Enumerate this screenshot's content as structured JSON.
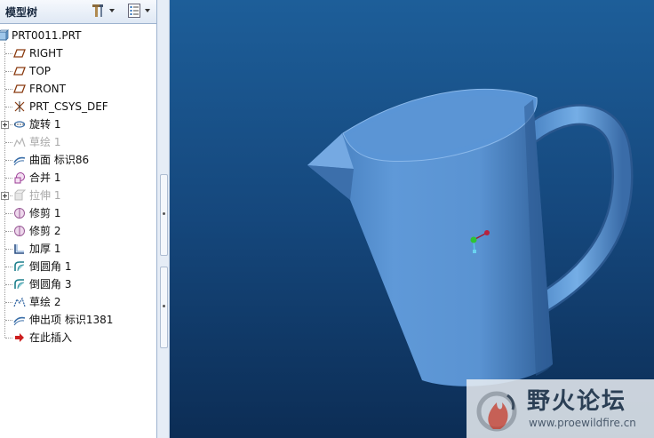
{
  "panel": {
    "title": "模型树"
  },
  "tree": {
    "items": [
      {
        "label": "PRT0011.PRT",
        "icon": "part-icon",
        "dim": false
      },
      {
        "label": "RIGHT",
        "icon": "datum-plane-icon",
        "dim": false
      },
      {
        "label": "TOP",
        "icon": "datum-plane-icon",
        "dim": false
      },
      {
        "label": "FRONT",
        "icon": "datum-plane-icon",
        "dim": false
      },
      {
        "label": "PRT_CSYS_DEF",
        "icon": "coordinate-system-icon",
        "dim": false
      },
      {
        "label": "旋转 1",
        "icon": "revolve-icon",
        "dim": false,
        "expandable": true
      },
      {
        "label": "草绘 1",
        "icon": "sketch-icon",
        "dim": true
      },
      {
        "label": "曲面 标识86",
        "icon": "surface-icon",
        "dim": false
      },
      {
        "label": "合并 1",
        "icon": "merge-icon",
        "dim": false
      },
      {
        "label": "拉伸 1",
        "icon": "extrude-icon",
        "dim": true,
        "expandable": true
      },
      {
        "label": "修剪 1",
        "icon": "trim-icon",
        "dim": false
      },
      {
        "label": "修剪 2",
        "icon": "trim-icon",
        "dim": false
      },
      {
        "label": "加厚 1",
        "icon": "thicken-icon",
        "dim": false
      },
      {
        "label": "倒圆角 1",
        "icon": "round-icon",
        "dim": false
      },
      {
        "label": "倒圆角 3",
        "icon": "round-icon",
        "dim": false
      },
      {
        "label": "草绘 2",
        "icon": "sketch-icon",
        "dim": false
      },
      {
        "label": "伸出项 标识1381",
        "icon": "protrusion-icon",
        "dim": false
      },
      {
        "label": "在此插入",
        "icon": "insert-here-arrow-icon",
        "dim": false
      }
    ]
  },
  "watermark": {
    "text": "野火论坛",
    "url": "www.proewildfire.cn"
  },
  "colors": {
    "viewport_top": "#1d5e99",
    "viewport_bottom": "#0c2d55",
    "model": "#5b93d2",
    "insert_arrow": "#cc1f1f"
  }
}
